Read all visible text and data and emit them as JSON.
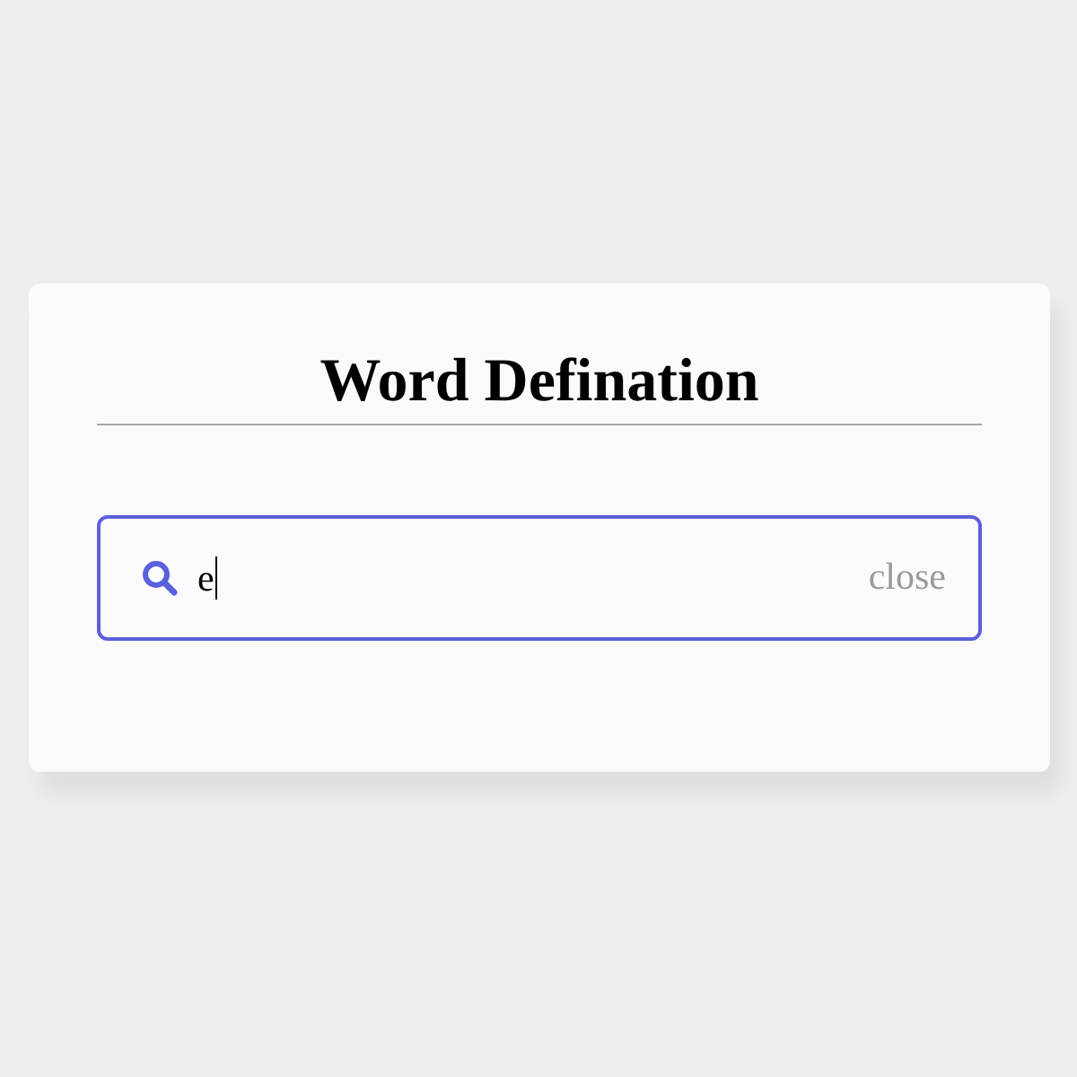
{
  "title": "Word Defination",
  "search": {
    "value": "e",
    "close_label": "close"
  }
}
